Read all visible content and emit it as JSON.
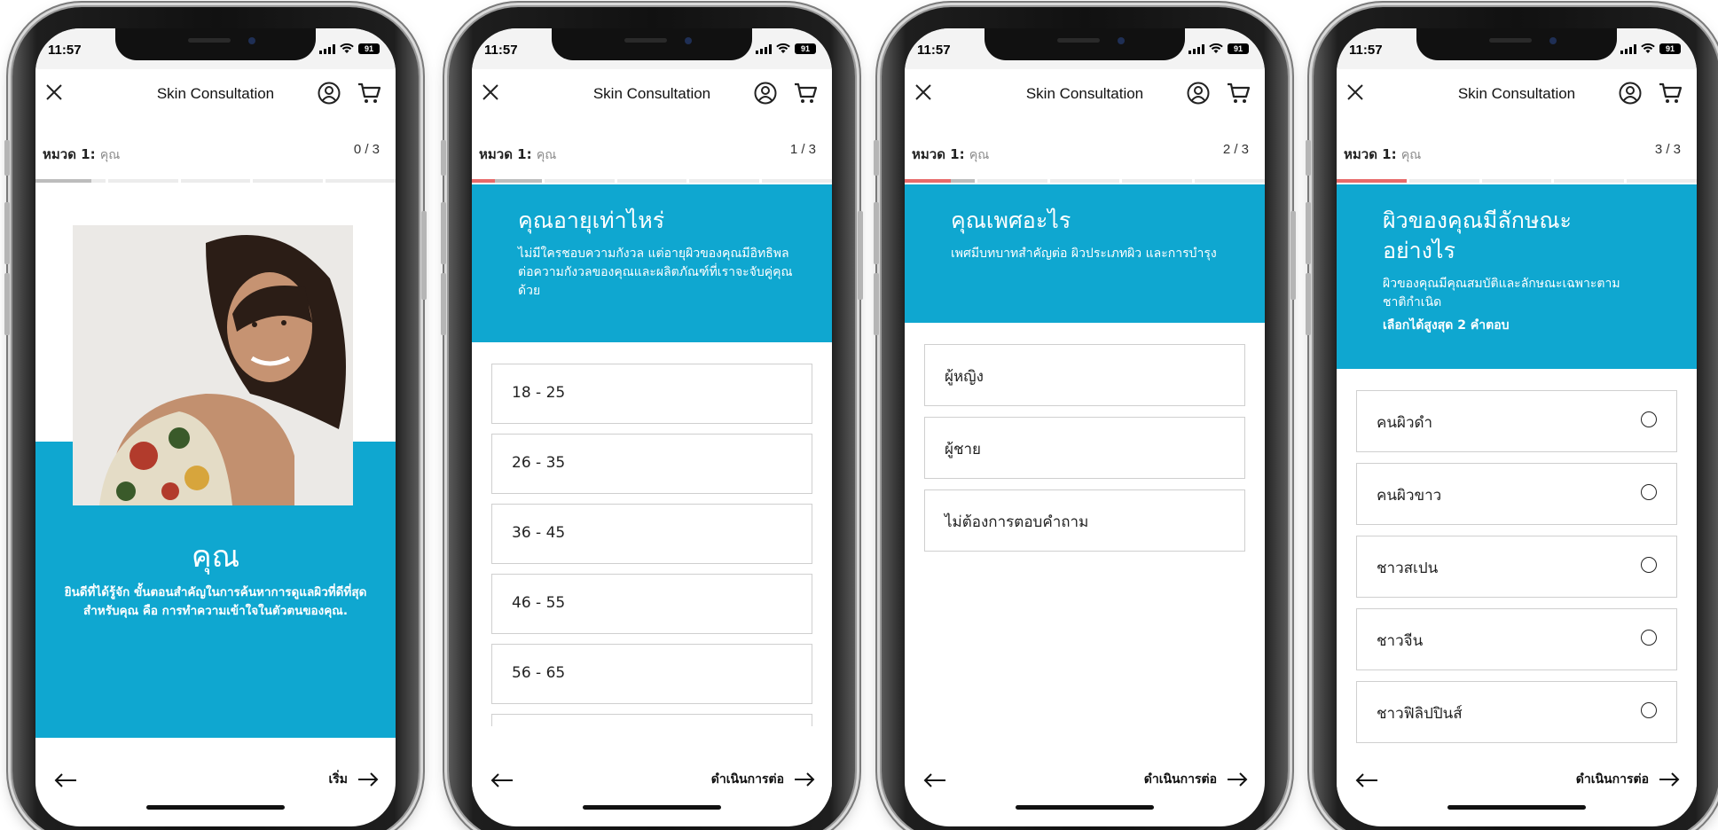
{
  "common": {
    "time": "11:57",
    "battery": "91",
    "app_title": "Skin Consultation",
    "section_label": "หมวด 1:",
    "section_name": "คุณ"
  },
  "colors": {
    "accent_blue": "#0fa7d0",
    "progress_red": "#e86a6a",
    "progress_grey": "#bdbdbd"
  },
  "screens": [
    {
      "count": "0 / 3",
      "progress_fraction": 0.0,
      "intro_title": "คุณ",
      "intro_desc": "ยินดีที่ได้รู้จัก  ขั้นตอนสำคัญในการค้นหาการดูแลผิวที่ดีที่สุดสำหรับคุณ คือ การทำความเข้าใจในตัวตนของคุณ.",
      "next_label": "เริ่ม"
    },
    {
      "count": "1 / 3",
      "progress_fraction": 0.33,
      "question": "คุณอายุเท่าไหร่",
      "description": "ไม่มีใครชอบความกังวล แต่อายุผิวของคุณมีอิทธิพลต่อความกังวลของคุณและผลิตภัณฑ์ที่เราจะจับคู่คุณด้วย",
      "options": [
        "18 - 25",
        "26 - 35",
        "36 - 45",
        "46 - 55",
        "56 - 65"
      ],
      "next_label": "ดำเนินการต่อ"
    },
    {
      "count": "2 / 3",
      "progress_fraction": 0.66,
      "question": "คุณเพศอะไร",
      "description": "เพศมีบทบาทสำคัญต่อ ผิวประเภทผิว และการบำรุง",
      "options": [
        "ผู้หญิง",
        "ผู้ชาย",
        "ไม่ต้องการตอบคำถาม"
      ],
      "next_label": "ดำเนินการต่อ"
    },
    {
      "count": "3 / 3",
      "progress_fraction": 1.0,
      "question": "ผิวของคุณมีลักษณะอย่างไร",
      "description": "ผิวของคุณมีคุณสมบัติและลักษณะเฉพาะตามชาติกำเนิด",
      "note": "เลือกได้สูงสุด 2 คำตอบ",
      "options": [
        "คนผิวดำ",
        "คนผิวขาว",
        "ชาวสเปน",
        "ชาวจีน",
        "ชาวฟิลิปปินส์"
      ],
      "next_label": "ดำเนินการต่อ"
    }
  ]
}
